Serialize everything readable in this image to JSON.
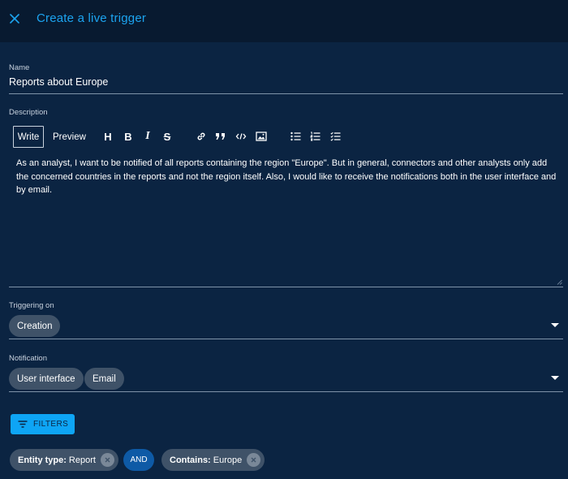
{
  "header": {
    "title": "Create a live trigger",
    "close_icon": "close-icon"
  },
  "name": {
    "label": "Name",
    "value": "Reports about Europe"
  },
  "description": {
    "label": "Description",
    "tabs": {
      "write": "Write",
      "preview": "Preview"
    },
    "toolbar": {
      "heading": "H",
      "bold": "B",
      "italic": "I",
      "strike": "S"
    },
    "value": "As an analyst, I want to be notified of all reports containing the region \"Europe\". But in general, connectors and other analysts only add the concerned countries in the reports and not the region itself. Also, I would like to receive the notifications both in the user interface and by email."
  },
  "triggering_on": {
    "label": "Triggering on",
    "chips": [
      "Creation"
    ]
  },
  "notification": {
    "label": "Notification",
    "chips": [
      "User interface",
      "Email"
    ]
  },
  "filters": {
    "button_label": "FILTERS",
    "entity_type": {
      "key": "Entity type:",
      "value": "Report"
    },
    "operator": "AND",
    "contains": {
      "key": "Contains:",
      "value": "Europe"
    }
  },
  "colors": {
    "background": "#0b2442",
    "header": "#081a30",
    "accent": "#1ca4f0",
    "button": "#0ea5f5",
    "chip": "#3f5268",
    "and_chip": "#0e5aa6"
  }
}
